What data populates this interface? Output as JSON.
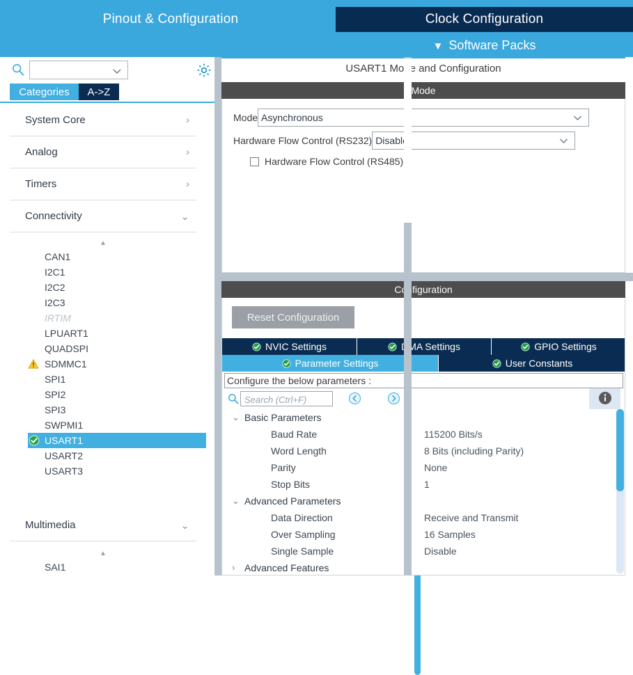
{
  "topbar": {
    "tabs": [
      {
        "label": "Pinout & Configuration",
        "active": true
      },
      {
        "label": "Clock Configuration",
        "active": false
      }
    ],
    "software_packs": {
      "label": "Software Packs",
      "icon": "chevron-down-icon"
    },
    "colors": {
      "accent_blue": "#3aa8dc",
      "dark_navy": "#082b51"
    }
  },
  "sidebar": {
    "search": {
      "value": "",
      "placeholder": "",
      "icon": "search-icon"
    },
    "gear": {
      "icon": "gear-icon"
    },
    "segments": [
      {
        "label": "Categories",
        "active": true
      },
      {
        "label": "A->Z",
        "active": false
      }
    ],
    "categories": [
      {
        "label": "System Core",
        "expanded": false,
        "chevron": "chevron-right-icon"
      },
      {
        "label": "Analog",
        "expanded": false,
        "chevron": "chevron-right-icon"
      },
      {
        "label": "Timers",
        "expanded": false,
        "chevron": "chevron-right-icon"
      },
      {
        "label": "Connectivity",
        "expanded": true,
        "chevron": "chevron-down-icon"
      },
      {
        "label": "Multimedia",
        "expanded": true,
        "chevron": "chevron-down-icon"
      }
    ],
    "connectivity_items": [
      {
        "label": "CAN1",
        "state": "normal",
        "badge": "none"
      },
      {
        "label": "I2C1",
        "state": "normal",
        "badge": "none"
      },
      {
        "label": "I2C2",
        "state": "normal",
        "badge": "none"
      },
      {
        "label": "I2C3",
        "state": "normal",
        "badge": "none"
      },
      {
        "label": "IRTIM",
        "state": "disabled",
        "badge": "none"
      },
      {
        "label": "LPUART1",
        "state": "normal",
        "badge": "none"
      },
      {
        "label": "QUADSPI",
        "state": "normal",
        "badge": "none"
      },
      {
        "label": "SDMMC1",
        "state": "normal",
        "badge": "warning"
      },
      {
        "label": "SPI1",
        "state": "normal",
        "badge": "none"
      },
      {
        "label": "SPI2",
        "state": "normal",
        "badge": "none"
      },
      {
        "label": "SPI3",
        "state": "normal",
        "badge": "none"
      },
      {
        "label": "SWPMI1",
        "state": "normal",
        "badge": "none"
      },
      {
        "label": "USART1",
        "state": "selected",
        "badge": "check"
      },
      {
        "label": "USART2",
        "state": "normal",
        "badge": "none"
      },
      {
        "label": "USART3",
        "state": "normal",
        "badge": "none"
      }
    ],
    "multimedia_items": [
      {
        "label": "SAI1",
        "state": "normal",
        "badge": "none"
      }
    ]
  },
  "main": {
    "title": "USART1 Mode and Configuration",
    "mode_section": {
      "header": "Mode",
      "fields": [
        {
          "label": "Mode",
          "value": "Asynchronous",
          "type": "select"
        },
        {
          "label": "Hardware Flow Control (RS232)",
          "value": "Disable",
          "type": "select"
        }
      ],
      "checkbox": {
        "label": "Hardware Flow Control (RS485)",
        "checked": false
      }
    },
    "config_section": {
      "header": "Configuration",
      "reset_button": "Reset Configuration",
      "tabs_row1": [
        {
          "label": "NVIC Settings",
          "active": false,
          "badge": "check"
        },
        {
          "label": "DMA Settings",
          "active": false,
          "badge": "check"
        },
        {
          "label": "GPIO Settings",
          "active": false,
          "badge": "check"
        }
      ],
      "tabs_row2": [
        {
          "label": "Parameter Settings",
          "active": true,
          "badge": "check"
        },
        {
          "label": "User Constants",
          "active": false,
          "badge": "check"
        }
      ],
      "hint": "Configure the below parameters :",
      "toolbar": {
        "search_value": "",
        "search_placeholder": "Search (Ctrl+F)",
        "search_icon": "search-icon",
        "prev_icon": "circle-left-arrow-icon",
        "next_icon": "circle-right-arrow-icon",
        "info_icon": "info-icon"
      },
      "parameter_groups": [
        {
          "name": "Basic Parameters",
          "expanded": true,
          "rows": [
            {
              "key": "Baud Rate",
              "value": "115200 Bits/s"
            },
            {
              "key": "Word Length",
              "value": "8 Bits (including Parity)"
            },
            {
              "key": "Parity",
              "value": "None"
            },
            {
              "key": "Stop Bits",
              "value": "1"
            }
          ]
        },
        {
          "name": "Advanced Parameters",
          "expanded": true,
          "rows": [
            {
              "key": "Data Direction",
              "value": "Receive and Transmit"
            },
            {
              "key": "Over Sampling",
              "value": "16 Samples"
            },
            {
              "key": "Single Sample",
              "value": "Disable"
            }
          ]
        },
        {
          "name": "Advanced Features",
          "expanded": false,
          "rows": []
        }
      ]
    }
  }
}
